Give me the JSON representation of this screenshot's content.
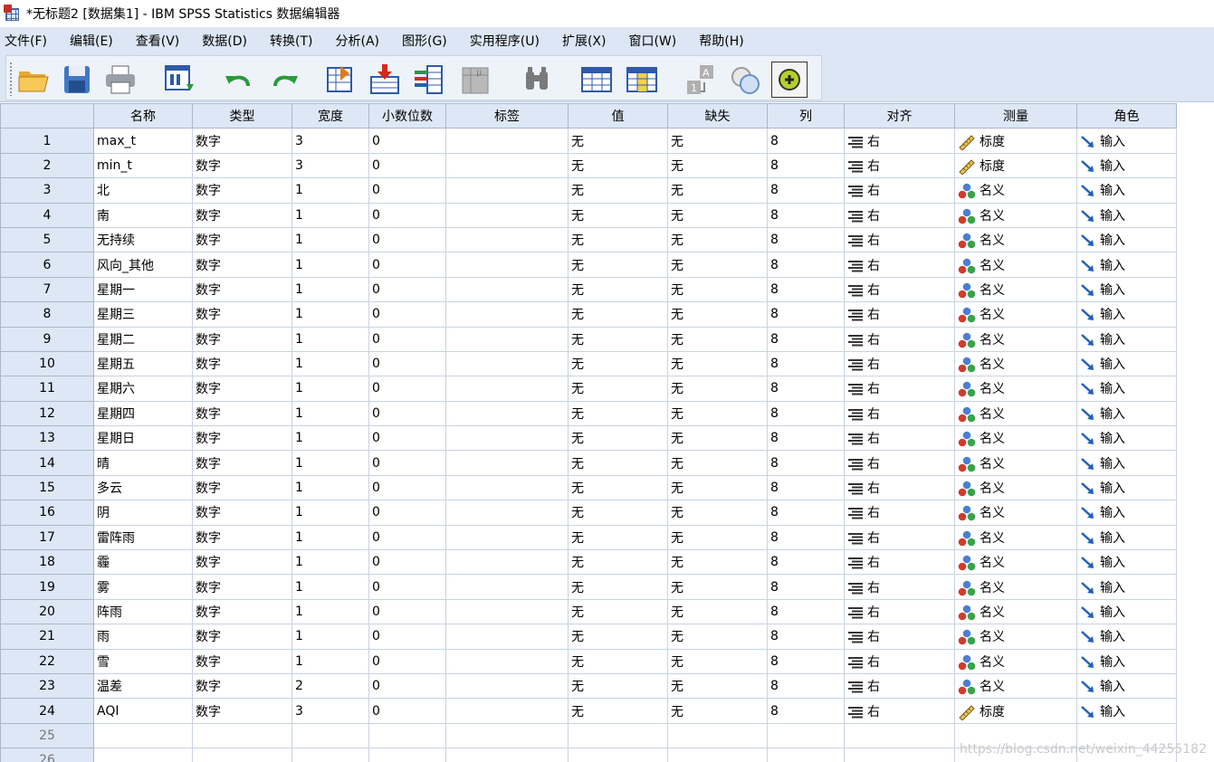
{
  "window": {
    "title": "*无标题2 [数据集1] - IBM SPSS Statistics 数据编辑器"
  },
  "menu": [
    "文件(F)",
    "编辑(E)",
    "查看(V)",
    "数据(D)",
    "转换(T)",
    "分析(A)",
    "图形(G)",
    "实用程序(U)",
    "扩展(X)",
    "窗口(W)",
    "帮助(H)"
  ],
  "toolbar": {
    "buttons": [
      "open-folder-icon",
      "save-icon",
      "print-icon",
      "recall-dialog-icon",
      "undo-icon",
      "redo-icon",
      "goto-case-icon",
      "goto-variable-icon",
      "variables-icon",
      "run-descriptives-icon",
      "find-icon",
      "insert-cases-icon",
      "insert-variable-icon",
      "split-file-icon",
      "weight-cases-icon",
      "select-cases-icon",
      "value-labels-icon",
      "use-sets-icon"
    ]
  },
  "columns": [
    "名称",
    "类型",
    "宽度",
    "小数位数",
    "标签",
    "值",
    "缺失",
    "列",
    "对齐",
    "测量",
    "角色"
  ],
  "rows": [
    {
      "n": "1",
      "name": "max_t",
      "type": "数字",
      "width": "3",
      "decimals": "0",
      "label": "",
      "values": "无",
      "missing": "无",
      "columns": "8",
      "align": "右",
      "measure": "标度",
      "role": "输入"
    },
    {
      "n": "2",
      "name": "min_t",
      "type": "数字",
      "width": "3",
      "decimals": "0",
      "label": "",
      "values": "无",
      "missing": "无",
      "columns": "8",
      "align": "右",
      "measure": "标度",
      "role": "输入"
    },
    {
      "n": "3",
      "name": "北",
      "type": "数字",
      "width": "1",
      "decimals": "0",
      "label": "",
      "values": "无",
      "missing": "无",
      "columns": "8",
      "align": "右",
      "measure": "名义",
      "role": "输入"
    },
    {
      "n": "4",
      "name": "南",
      "type": "数字",
      "width": "1",
      "decimals": "0",
      "label": "",
      "values": "无",
      "missing": "无",
      "columns": "8",
      "align": "右",
      "measure": "名义",
      "role": "输入"
    },
    {
      "n": "5",
      "name": "无持续",
      "type": "数字",
      "width": "1",
      "decimals": "0",
      "label": "",
      "values": "无",
      "missing": "无",
      "columns": "8",
      "align": "右",
      "measure": "名义",
      "role": "输入"
    },
    {
      "n": "6",
      "name": "风向_其他",
      "type": "数字",
      "width": "1",
      "decimals": "0",
      "label": "",
      "values": "无",
      "missing": "无",
      "columns": "8",
      "align": "右",
      "measure": "名义",
      "role": "输入"
    },
    {
      "n": "7",
      "name": "星期一",
      "type": "数字",
      "width": "1",
      "decimals": "0",
      "label": "",
      "values": "无",
      "missing": "无",
      "columns": "8",
      "align": "右",
      "measure": "名义",
      "role": "输入"
    },
    {
      "n": "8",
      "name": "星期三",
      "type": "数字",
      "width": "1",
      "decimals": "0",
      "label": "",
      "values": "无",
      "missing": "无",
      "columns": "8",
      "align": "右",
      "measure": "名义",
      "role": "输入"
    },
    {
      "n": "9",
      "name": "星期二",
      "type": "数字",
      "width": "1",
      "decimals": "0",
      "label": "",
      "values": "无",
      "missing": "无",
      "columns": "8",
      "align": "右",
      "measure": "名义",
      "role": "输入"
    },
    {
      "n": "10",
      "name": "星期五",
      "type": "数字",
      "width": "1",
      "decimals": "0",
      "label": "",
      "values": "无",
      "missing": "无",
      "columns": "8",
      "align": "右",
      "measure": "名义",
      "role": "输入"
    },
    {
      "n": "11",
      "name": "星期六",
      "type": "数字",
      "width": "1",
      "decimals": "0",
      "label": "",
      "values": "无",
      "missing": "无",
      "columns": "8",
      "align": "右",
      "measure": "名义",
      "role": "输入"
    },
    {
      "n": "12",
      "name": "星期四",
      "type": "数字",
      "width": "1",
      "decimals": "0",
      "label": "",
      "values": "无",
      "missing": "无",
      "columns": "8",
      "align": "右",
      "measure": "名义",
      "role": "输入"
    },
    {
      "n": "13",
      "name": "星期日",
      "type": "数字",
      "width": "1",
      "decimals": "0",
      "label": "",
      "values": "无",
      "missing": "无",
      "columns": "8",
      "align": "右",
      "measure": "名义",
      "role": "输入"
    },
    {
      "n": "14",
      "name": "晴",
      "type": "数字",
      "width": "1",
      "decimals": "0",
      "label": "",
      "values": "无",
      "missing": "无",
      "columns": "8",
      "align": "右",
      "measure": "名义",
      "role": "输入"
    },
    {
      "n": "15",
      "name": "多云",
      "type": "数字",
      "width": "1",
      "decimals": "0",
      "label": "",
      "values": "无",
      "missing": "无",
      "columns": "8",
      "align": "右",
      "measure": "名义",
      "role": "输入"
    },
    {
      "n": "16",
      "name": "阴",
      "type": "数字",
      "width": "1",
      "decimals": "0",
      "label": "",
      "values": "无",
      "missing": "无",
      "columns": "8",
      "align": "右",
      "measure": "名义",
      "role": "输入"
    },
    {
      "n": "17",
      "name": "雷阵雨",
      "type": "数字",
      "width": "1",
      "decimals": "0",
      "label": "",
      "values": "无",
      "missing": "无",
      "columns": "8",
      "align": "右",
      "measure": "名义",
      "role": "输入"
    },
    {
      "n": "18",
      "name": "霾",
      "type": "数字",
      "width": "1",
      "decimals": "0",
      "label": "",
      "values": "无",
      "missing": "无",
      "columns": "8",
      "align": "右",
      "measure": "名义",
      "role": "输入"
    },
    {
      "n": "19",
      "name": "雾",
      "type": "数字",
      "width": "1",
      "decimals": "0",
      "label": "",
      "values": "无",
      "missing": "无",
      "columns": "8",
      "align": "右",
      "measure": "名义",
      "role": "输入"
    },
    {
      "n": "20",
      "name": "阵雨",
      "type": "数字",
      "width": "1",
      "decimals": "0",
      "label": "",
      "values": "无",
      "missing": "无",
      "columns": "8",
      "align": "右",
      "measure": "名义",
      "role": "输入"
    },
    {
      "n": "21",
      "name": "雨",
      "type": "数字",
      "width": "1",
      "decimals": "0",
      "label": "",
      "values": "无",
      "missing": "无",
      "columns": "8",
      "align": "右",
      "measure": "名义",
      "role": "输入"
    },
    {
      "n": "22",
      "name": "雪",
      "type": "数字",
      "width": "1",
      "decimals": "0",
      "label": "",
      "values": "无",
      "missing": "无",
      "columns": "8",
      "align": "右",
      "measure": "名义",
      "role": "输入"
    },
    {
      "n": "23",
      "name": "温差",
      "type": "数字",
      "width": "2",
      "decimals": "0",
      "label": "",
      "values": "无",
      "missing": "无",
      "columns": "8",
      "align": "右",
      "measure": "名义",
      "role": "输入"
    },
    {
      "n": "24",
      "name": "AQI",
      "type": "数字",
      "width": "3",
      "decimals": "0",
      "label": "",
      "values": "无",
      "missing": "无",
      "columns": "8",
      "align": "右",
      "measure": "标度",
      "role": "输入"
    }
  ],
  "empty_rows": [
    "25",
    "26"
  ],
  "watermark": "https://blog.csdn.net/weixin_44255182"
}
